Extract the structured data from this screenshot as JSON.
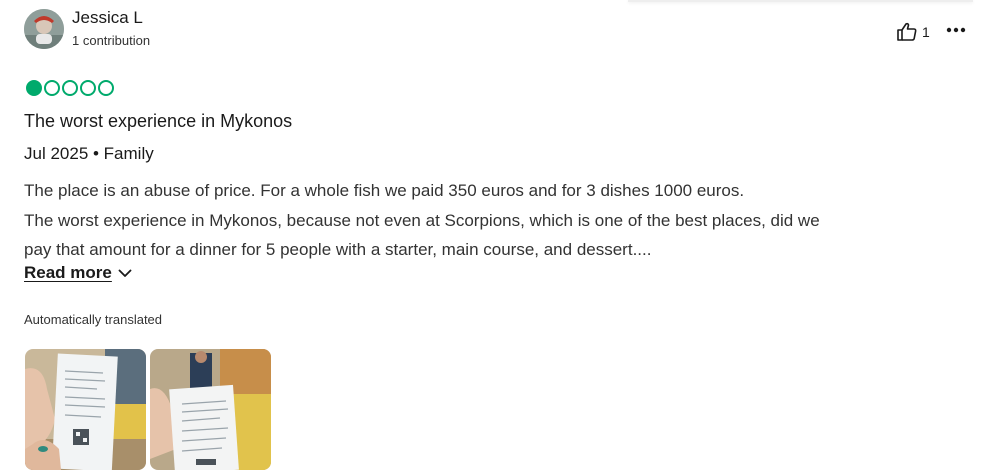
{
  "review": {
    "author": {
      "name": "Jessica L",
      "contributions": "1 contribution"
    },
    "helpful_count": "1",
    "rating": {
      "value": 1,
      "max": 5
    },
    "title": "The worst experience in Mykonos",
    "meta": "Jul 2025 • Family",
    "body_lines": [
      "The place is an abuse of price. For a whole fish we paid 350 euros and for 3 dishes 1000 euros.",
      "The worst experience in Mykonos, because not even at Scorpions, which is one of the best places, did we",
      "pay that amount for a dinner for 5 people with a starter, main course, and dessert...."
    ],
    "read_more_label": "Read more",
    "translation_note": "Automatically translated",
    "photos": [
      {
        "icon": "receipt-photo"
      },
      {
        "icon": "receipt-photo"
      }
    ]
  },
  "colors": {
    "accent": "#00aa6c",
    "text": "#1a1a1a"
  },
  "icons": {
    "helpful": "thumbs-up-icon",
    "more": "more-options-icon",
    "read_more": "chevron-down-icon"
  }
}
